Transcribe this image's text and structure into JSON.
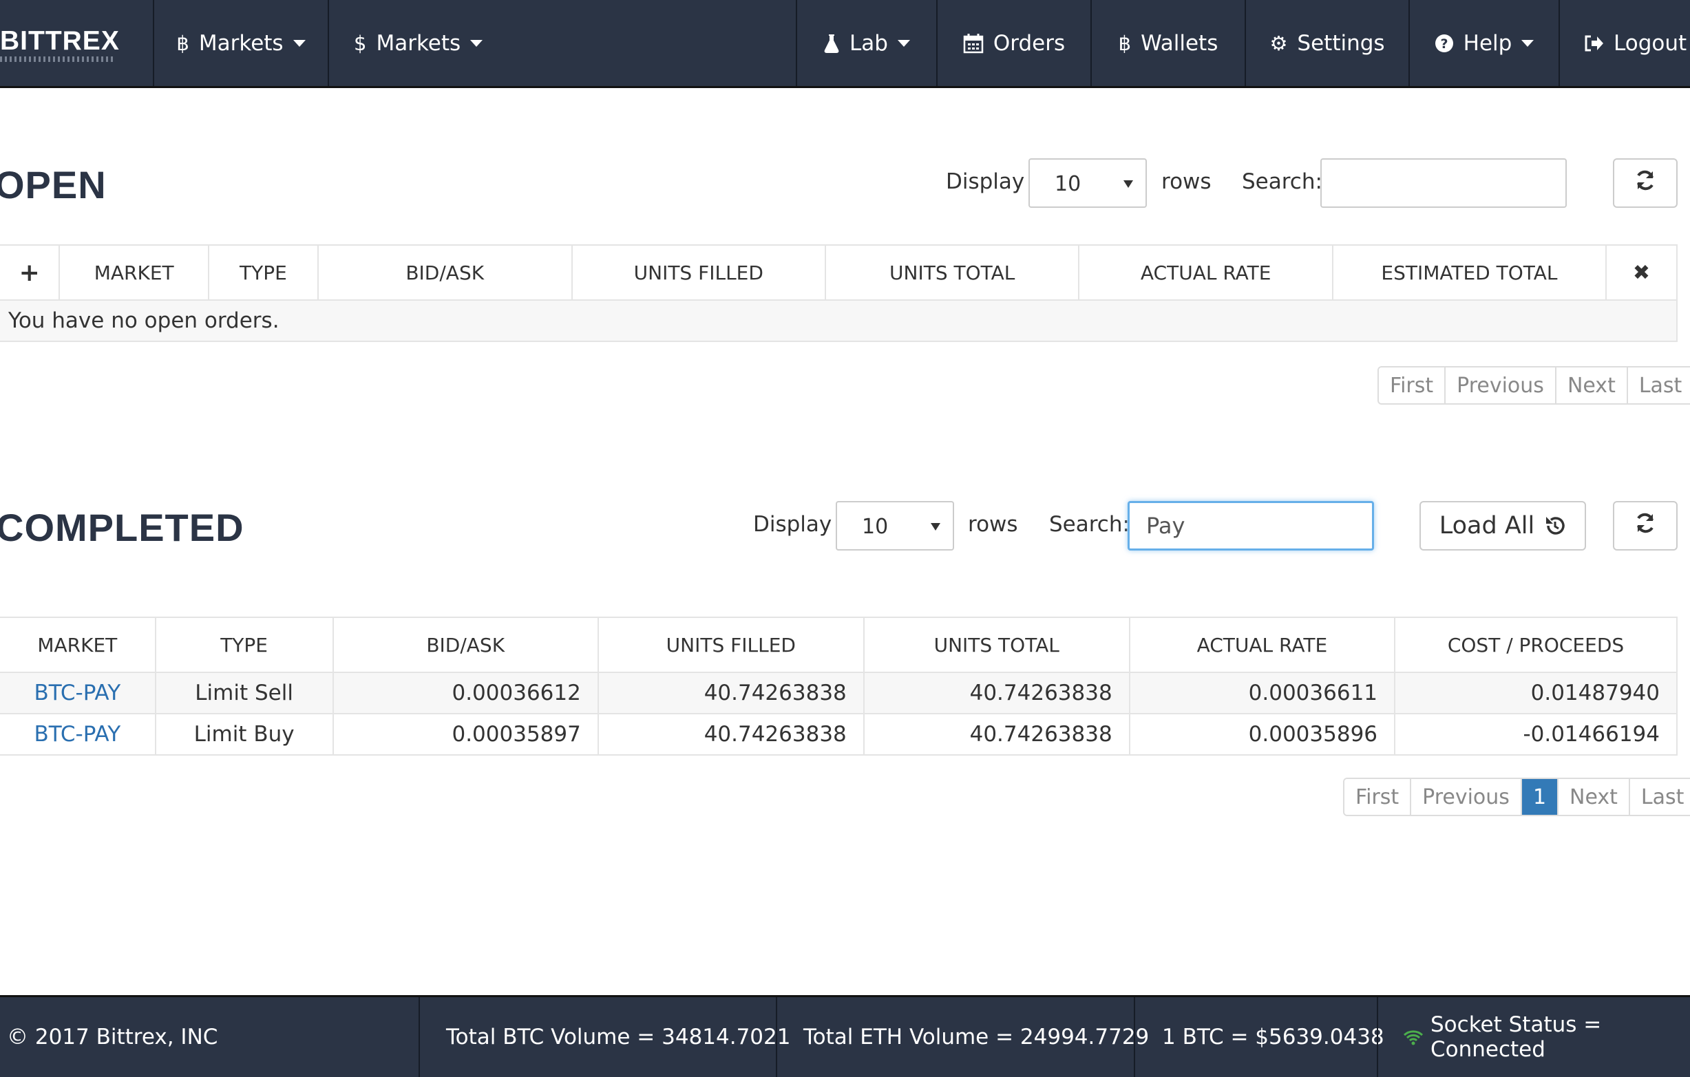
{
  "nav": {
    "brand": "BITTREX",
    "items": [
      {
        "label": "Markets",
        "icon": "bitcoin-icon"
      },
      {
        "label": "Markets",
        "icon": "dollar-icon"
      },
      {
        "label": "Lab",
        "icon": "flask-icon"
      },
      {
        "label": "Orders",
        "icon": "calendar-icon"
      },
      {
        "label": "Wallets",
        "icon": "bitcoin-icon"
      },
      {
        "label": "Settings",
        "icon": "gear-icon"
      },
      {
        "label": "Help",
        "icon": "question-icon"
      },
      {
        "label": "Logout",
        "icon": "logout-icon"
      }
    ]
  },
  "open": {
    "title": "OPEN",
    "display_label": "Display",
    "rows_value": "10",
    "rows_label": "rows",
    "search_label": "Search:",
    "search_value": "",
    "add_symbol": "+",
    "close_symbol": "✖",
    "columns": [
      "MARKET",
      "TYPE",
      "BID/ASK",
      "UNITS FILLED",
      "UNITS TOTAL",
      "ACTUAL RATE",
      "ESTIMATED TOTAL"
    ],
    "empty_message": "You have no open orders.",
    "pager": [
      "First",
      "Previous",
      "Next",
      "Last"
    ]
  },
  "completed": {
    "title": "COMPLETED",
    "display_label": "Display",
    "rows_value": "10",
    "rows_label": "rows",
    "search_label": "Search:",
    "search_value": "Pay",
    "load_all_label": "Load All",
    "columns": [
      "MARKET",
      "TYPE",
      "BID/ASK",
      "UNITS FILLED",
      "UNITS TOTAL",
      "ACTUAL RATE",
      "COST / PROCEEDS"
    ],
    "rows": [
      {
        "market": "BTC-PAY",
        "type": "Limit Sell",
        "bid_ask": "0.00036612",
        "units_filled": "40.74263838",
        "units_total": "40.74263838",
        "actual_rate": "0.00036611",
        "cost_proceeds": "0.01487940"
      },
      {
        "market": "BTC-PAY",
        "type": "Limit Buy",
        "bid_ask": "0.00035897",
        "units_filled": "40.74263838",
        "units_total": "40.74263838",
        "actual_rate": "0.00035896",
        "cost_proceeds": "-0.01466194"
      }
    ],
    "pager": [
      "First",
      "Previous",
      "1",
      "Next",
      "Last"
    ],
    "active_page": "1"
  },
  "footer": {
    "copyright": "© 2017 Bittrex, INC",
    "btc_volume": "Total BTC Volume = 34814.7021",
    "eth_volume": "Total ETH Volume = 24994.7729",
    "btc_price": "1 BTC = $5639.0438",
    "socket_status": "Socket Status = Connected"
  },
  "colors": {
    "nav_bg": "#2b3445",
    "link": "#2a6fb0",
    "active_page": "#337ab7",
    "socket_ok": "#4cae4c"
  }
}
